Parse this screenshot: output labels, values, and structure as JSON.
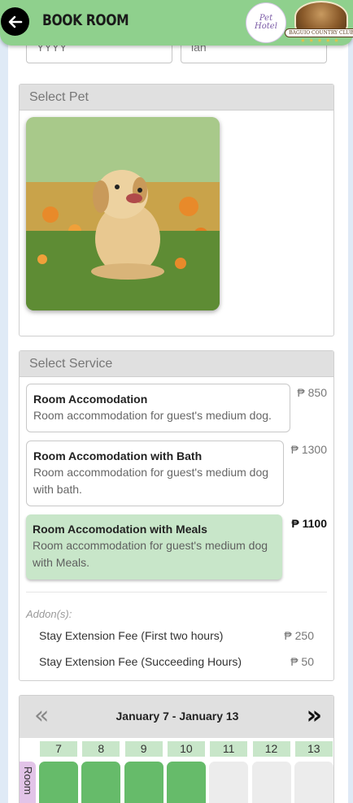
{
  "header": {
    "title": "BOOK ROOM",
    "back_icon": "arrow-left-icon",
    "logo_pet_text_1": "Pet",
    "logo_pet_text_2": "Hotel",
    "logo_club_text": "BAGUIO COUNTRY CLUB",
    "accent": "#8fd08d"
  },
  "top_inputs": [
    {
      "value": "YYYY"
    },
    {
      "value": "lan"
    }
  ],
  "select_pet": {
    "heading": "Select Pet"
  },
  "select_service": {
    "heading": "Select Service",
    "services": [
      {
        "name": "Room Accomodation",
        "description": "Room accommodation for guest's medium dog.",
        "price": "₱ 850",
        "selected": false
      },
      {
        "name": "Room Accomodation with Bath",
        "description": "Room accommodation for guest's medium dog with bath.",
        "price": "₱ 1300",
        "selected": false
      },
      {
        "name": "Room Accomodation with Meals",
        "description": "Room accommodation for guest's medium dog with Meals.",
        "price": "₱ 1100",
        "selected": true
      }
    ],
    "addons_label": "Addon(s):",
    "addons": [
      {
        "name": "Stay Extension Fee (First two hours)",
        "price": "₱ 250"
      },
      {
        "name": "Stay Extension Fee (Succeeding Hours)",
        "price": "₱ 50"
      }
    ]
  },
  "calendar": {
    "range": "January 7 - January 13",
    "prev_label": "«",
    "next_label": "»",
    "days": [
      "7",
      "8",
      "9",
      "10",
      "11",
      "12",
      "13"
    ],
    "booked": [
      true,
      true,
      true,
      true,
      false,
      false,
      false
    ],
    "room_label": "Room",
    "booked_color": "#66bb6a",
    "free_color": "#ececec"
  }
}
